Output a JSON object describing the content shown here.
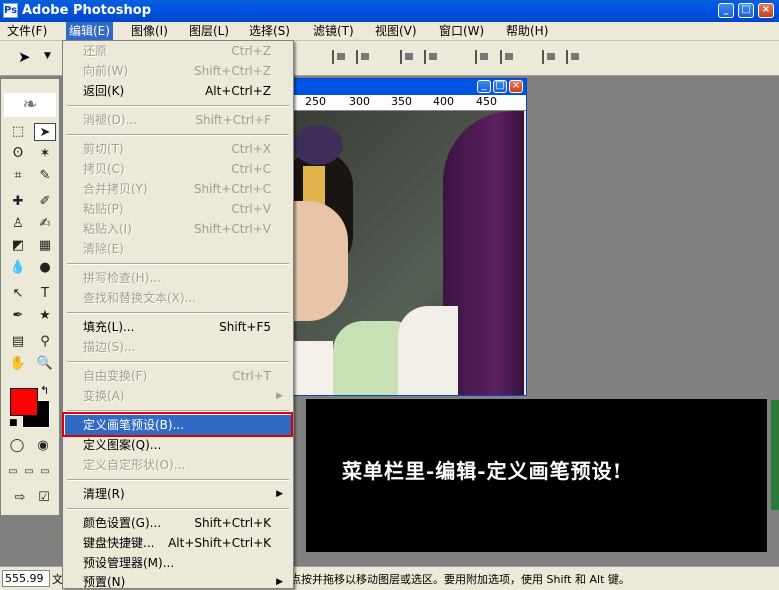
{
  "app": {
    "title": "Adobe Photoshop",
    "icon": "photoshop-icon",
    "window_buttons": [
      "minimize",
      "maximize",
      "close"
    ]
  },
  "menubar": {
    "items": [
      {
        "label": "文件(F)"
      },
      {
        "label": "编辑(E)"
      },
      {
        "label": "图像(I)"
      },
      {
        "label": "图层(L)"
      },
      {
        "label": "选择(S)"
      },
      {
        "label": "滤镜(T)"
      },
      {
        "label": "视图(V)"
      },
      {
        "label": "窗口(W)"
      },
      {
        "label": "帮助(H)"
      }
    ],
    "active": "编辑(E)"
  },
  "edit_menu": {
    "items": [
      {
        "label": "还原",
        "shortcut": "Ctrl+Z",
        "enabled": false
      },
      {
        "label": "向前(W)",
        "shortcut": "Shift+Ctrl+Z",
        "enabled": false
      },
      {
        "label": "返回(K)",
        "shortcut": "Alt+Ctrl+Z",
        "enabled": true
      },
      {
        "label": "消褪(D)...",
        "shortcut": "Shift+Ctrl+F",
        "enabled": false
      },
      {
        "label": "剪切(T)",
        "shortcut": "Ctrl+X",
        "enabled": false
      },
      {
        "label": "拷贝(C)",
        "shortcut": "Ctrl+C",
        "enabled": false
      },
      {
        "label": "合并拷贝(Y)",
        "shortcut": "Shift+Ctrl+C",
        "enabled": false
      },
      {
        "label": "粘贴(P)",
        "shortcut": "Ctrl+V",
        "enabled": false
      },
      {
        "label": "粘贴入(I)",
        "shortcut": "Shift+Ctrl+V",
        "enabled": false
      },
      {
        "label": "清除(E)",
        "shortcut": "",
        "enabled": false
      },
      {
        "label": "拼写检查(H)...",
        "shortcut": "",
        "enabled": false
      },
      {
        "label": "查找和替换文本(X)...",
        "shortcut": "",
        "enabled": false
      },
      {
        "label": "填充(L)...",
        "shortcut": "Shift+F5",
        "enabled": true
      },
      {
        "label": "描边(S)...",
        "shortcut": "",
        "enabled": false
      },
      {
        "label": "自由变换(F)",
        "shortcut": "Ctrl+T",
        "enabled": false
      },
      {
        "label": "变换(A)",
        "shortcut": "",
        "enabled": false,
        "submenu": true
      },
      {
        "label": "定义画笔预设(B)...",
        "shortcut": "",
        "enabled": true,
        "highlighted": true
      },
      {
        "label": "定义图案(Q)...",
        "shortcut": "",
        "enabled": true
      },
      {
        "label": "定义自定形状(O)...",
        "shortcut": "",
        "enabled": false
      },
      {
        "label": "清理(R)",
        "shortcut": "",
        "enabled": true,
        "submenu": true
      },
      {
        "label": "颜色设置(G)...",
        "shortcut": "Shift+Ctrl+K",
        "enabled": true
      },
      {
        "label": "键盘快捷键...",
        "shortcut": "Alt+Shift+Ctrl+K",
        "enabled": true
      },
      {
        "label": "预设管理器(M)...",
        "shortcut": "",
        "enabled": true
      },
      {
        "label": "预置(N)",
        "shortcut": "",
        "enabled": true,
        "submenu": true
      }
    ]
  },
  "ruler": {
    "ticks": [
      "250",
      "300",
      "350",
      "400",
      "450"
    ]
  },
  "caption": {
    "text": "菜单栏里-编辑-定义画笔预设!"
  },
  "status": {
    "zoom": "555.99",
    "doc_label": "文",
    "message": "点按并拖移以移动图层或选区。要用附加选项，使用 Shift 和 Alt 键。"
  },
  "colors": {
    "foreground": "#ff0000",
    "background": "#000000",
    "highlight": "#316ac5",
    "annotation_box": "#e00000"
  }
}
